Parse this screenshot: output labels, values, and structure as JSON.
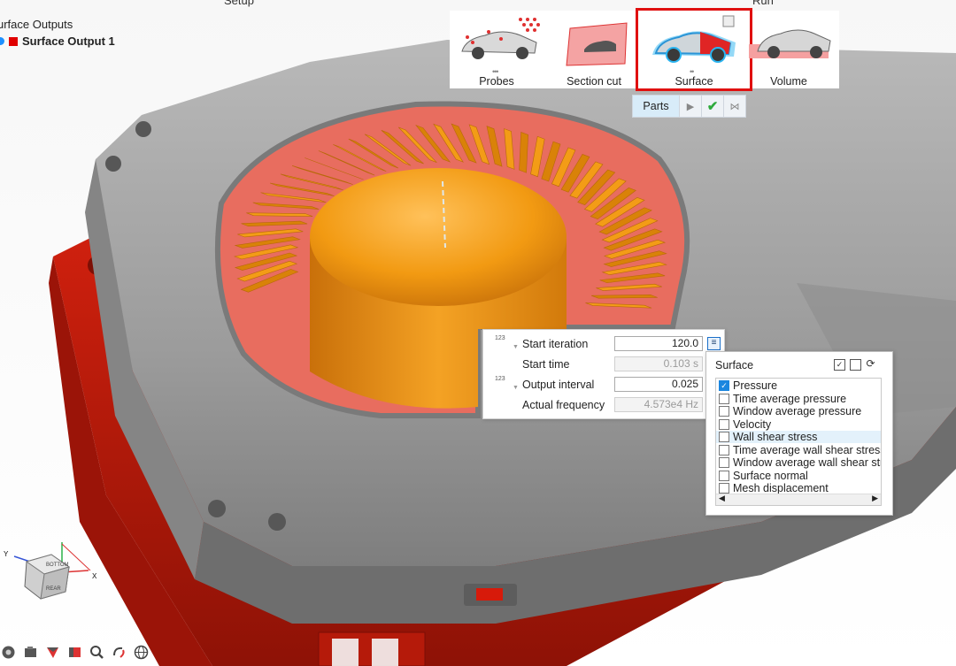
{
  "header": {
    "setup_label": "Setup",
    "run_label": "Run"
  },
  "tree": {
    "title": "urface Outputs",
    "items": [
      {
        "label": "Surface Output 1",
        "color": "#e00000"
      }
    ]
  },
  "ribbon": {
    "items": [
      {
        "label": "Probes",
        "icon": "probes-car-icon"
      },
      {
        "label": "Section cut",
        "icon": "section-cut-icon"
      },
      {
        "label": "Surface",
        "icon": "surface-car-icon",
        "selected": true
      },
      {
        "label": "Volume",
        "icon": "volume-car-icon"
      }
    ]
  },
  "parts_toolbar": {
    "label": "Parts",
    "play_icon": "play-icon",
    "apply_icon": "check-icon",
    "exit_icon": "exit-icon"
  },
  "output_settings": {
    "tag": "123",
    "rows": [
      {
        "label": "Start iteration",
        "value": "120.0",
        "readonly": false
      },
      {
        "label": "Start time",
        "value": "0.103 s",
        "readonly": true
      },
      {
        "label": "Output interval",
        "value": "0.025",
        "readonly": false
      },
      {
        "label": "Actual frequency",
        "value": "4.573e4 Hz",
        "readonly": true
      }
    ]
  },
  "surface_popup": {
    "title": "Surface",
    "options": [
      {
        "label": "Pressure",
        "checked": true,
        "highlighted": false
      },
      {
        "label": "Time average pressure",
        "checked": false,
        "highlighted": false
      },
      {
        "label": "Window average pressure",
        "checked": false,
        "highlighted": false
      },
      {
        "label": "Velocity",
        "checked": false,
        "highlighted": false
      },
      {
        "label": "Wall shear stress",
        "checked": false,
        "highlighted": true
      },
      {
        "label": "Time average wall shear stress",
        "checked": false,
        "highlighted": false
      },
      {
        "label": "Window average wall shear stre",
        "checked": false,
        "highlighted": false
      },
      {
        "label": "Surface normal",
        "checked": false,
        "highlighted": false
      },
      {
        "label": "Mesh displacement",
        "checked": false,
        "highlighted": false
      }
    ]
  },
  "triad": {
    "y_label": "Y",
    "x_label": "X",
    "cube_labels": [
      "BOTTOM",
      "REAR"
    ]
  },
  "colors": {
    "accent": "#1b86df",
    "selection": "#e01010",
    "part_red": "#d41c0c",
    "impeller": "#f0960f",
    "housing": "#9a9a9a"
  }
}
